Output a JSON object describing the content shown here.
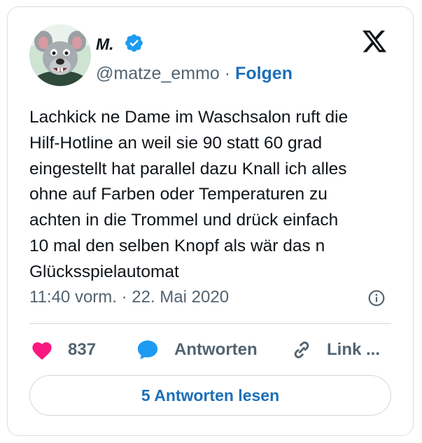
{
  "author": {
    "display_name": "M.",
    "handle": "@matze_emmo",
    "separator": " · ",
    "follow_label": "Folgen"
  },
  "tweet": {
    "text": "Lachkick ne Dame im Waschsalon ruft die\nHilf-Hotline an weil sie 90 statt 60 grad\neingestellt hat parallel dazu Knall ich alles\nohne auf Farben oder Temperaturen zu\nachten in die Trommel und drück einfach\n10 mal den selben Knopf als wär das n\nGlücksspielautomat",
    "timestamp": "11:40 vorm. · 22. Mai 2020"
  },
  "actions": {
    "like_count": "837",
    "reply_label": "Antworten",
    "copy_link_label": "Link ..."
  },
  "footer": {
    "read_replies_label": "5 Antworten lesen"
  },
  "colors": {
    "link_blue": "#1d6fb8",
    "verified_blue": "#1d9bf0",
    "like_pink": "#f91880",
    "muted_text": "#536471"
  }
}
